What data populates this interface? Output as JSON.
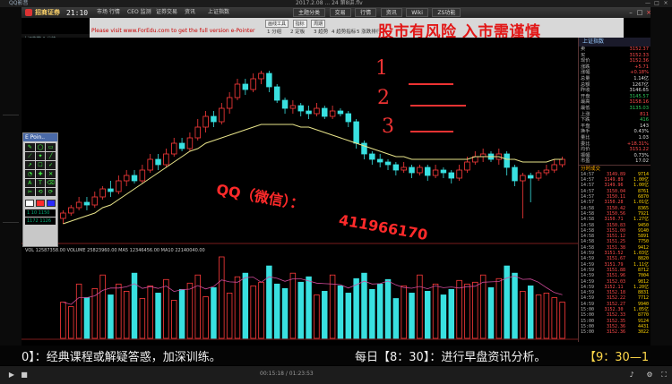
{
  "topbar": {
    "qq_title": "QQ影音",
    "video_info": "2017.2.08 ... 24 第8讲.flv",
    "min": "—",
    "max": "□",
    "close": "×"
  },
  "app": {
    "name": "招商证券",
    "clock": "21:10",
    "menu": [
      "市场 行情",
      "CEO 监测",
      "证券交易",
      "资讯",
      "上证指数"
    ],
    "tabs": [
      "主题分类",
      "交易",
      "行情",
      "资讯",
      "Wiki",
      "ZS功能"
    ],
    "stock_label": "上证指数 1 分钟"
  },
  "banner": {
    "url_text": "Please visit www.ForEdu.com to get the full version e-Pointer",
    "buttons": [
      "1 分组",
      "2 定板",
      "3 趋势",
      "4 趋势指标",
      "5 涨跌排行"
    ],
    "mini_buttons": [
      "画线工具",
      "指标",
      "周期"
    ],
    "warning": "股市有风险 入市需谨慎"
  },
  "point_toolbar": {
    "title": "E Poin..",
    "icons": [
      "✎",
      "◯",
      "▭",
      "⟋",
      "✦",
      "╱",
      "↗",
      "☐",
      "✓",
      "◔",
      "✚",
      "✕",
      "A",
      "T",
      "⌫",
      "✂",
      "⟲",
      "⟳"
    ],
    "colors": [
      "#ffffff",
      "#ff2a2a",
      "#2a2aff"
    ],
    "row1": "1 10 1150",
    "row2": "1172 1126"
  },
  "overlay": {
    "qq_text": "QQ（微信）：",
    "qq_number": "411966170",
    "numbers": [
      "1",
      "2",
      "3"
    ]
  },
  "right_panel": {
    "header": "上证指数",
    "kv": [
      {
        "k": "卖",
        "v": "3152.37",
        "c": "r"
      },
      {
        "k": "买",
        "v": "3152.33",
        "c": "r"
      },
      {
        "k": "现价",
        "v": "3152.36",
        "c": "r"
      },
      {
        "k": "涨跌",
        "v": "+5.71",
        "c": "r"
      },
      {
        "k": "涨幅",
        "v": "+0.18%",
        "c": "r"
      },
      {
        "k": "总量",
        "v": "1.14亿",
        "c": "w"
      },
      {
        "k": "总额",
        "v": "1267亿",
        "c": "w"
      },
      {
        "k": "昨收",
        "v": "3146.65",
        "c": "w"
      },
      {
        "k": "开盘",
        "v": "3145.57",
        "c": "g"
      },
      {
        "k": "最高",
        "v": "3158.16",
        "c": "r"
      },
      {
        "k": "最低",
        "v": "3135.03",
        "c": "g"
      },
      {
        "k": "上涨",
        "v": "811",
        "c": "r"
      },
      {
        "k": "下跌",
        "v": "416",
        "c": "g"
      },
      {
        "k": "平盘",
        "v": "143",
        "c": "w"
      },
      {
        "k": "换手",
        "v": "0.43%",
        "c": "w"
      },
      {
        "k": "量比",
        "v": "1.03",
        "c": "w"
      },
      {
        "k": "委比",
        "v": "+18.31%",
        "c": "r"
      },
      {
        "k": "均价",
        "v": "3151.22",
        "c": "r"
      },
      {
        "k": "振幅",
        "v": "0.73%",
        "c": "w"
      },
      {
        "k": "市盈",
        "v": "17.02",
        "c": "w"
      }
    ],
    "section": "分时成交",
    "trades": [
      {
        "t": "14:57",
        "p": "3149.89",
        "v": "9714"
      },
      {
        "t": "14:57",
        "p": "3149.89",
        "v": "1.00亿"
      },
      {
        "t": "14:57",
        "p": "3149.96",
        "v": "1.00亿"
      },
      {
        "t": "14:57",
        "p": "3150.04",
        "v": "8761"
      },
      {
        "t": "14:57",
        "p": "3150.11",
        "v": "6870"
      },
      {
        "t": "14:57",
        "p": "3150.28",
        "v": "1.01亿"
      },
      {
        "t": "14:58",
        "p": "3150.42",
        "v": "8365"
      },
      {
        "t": "14:58",
        "p": "3150.56",
        "v": "7921"
      },
      {
        "t": "14:58",
        "p": "3150.71",
        "v": "1.27亿"
      },
      {
        "t": "14:58",
        "p": "3150.83",
        "v": "9450"
      },
      {
        "t": "14:58",
        "p": "3151.00",
        "v": "9140"
      },
      {
        "t": "14:58",
        "p": "3151.12",
        "v": "5891"
      },
      {
        "t": "14:58",
        "p": "3151.25",
        "v": "7750"
      },
      {
        "t": "14:58",
        "p": "3151.38",
        "v": "9412"
      },
      {
        "t": "14:59",
        "p": "3151.52",
        "v": "1.03亿"
      },
      {
        "t": "14:59",
        "p": "3151.67",
        "v": "8820"
      },
      {
        "t": "14:59",
        "p": "3151.79",
        "v": "1.11亿"
      },
      {
        "t": "14:59",
        "p": "3151.88",
        "v": "8712"
      },
      {
        "t": "14:59",
        "p": "3151.96",
        "v": "7004"
      },
      {
        "t": "14:59",
        "p": "3152.03",
        "v": "9812"
      },
      {
        "t": "14:59",
        "p": "3152.11",
        "v": "1.20亿"
      },
      {
        "t": "14:59",
        "p": "3152.18",
        "v": "8831"
      },
      {
        "t": "14:59",
        "p": "3152.22",
        "v": "7712"
      },
      {
        "t": "14:59",
        "p": "3152.27",
        "v": "9940"
      },
      {
        "t": "15:00",
        "p": "3152.30",
        "v": "1.05亿"
      },
      {
        "t": "15:00",
        "p": "3152.33",
        "v": "8770"
      },
      {
        "t": "15:00",
        "p": "3152.35",
        "v": "9124"
      },
      {
        "t": "15:00",
        "p": "3152.36",
        "v": "4431"
      },
      {
        "t": "15:00",
        "p": "3152.36",
        "v": "3022"
      }
    ]
  },
  "ticker": {
    "left": "0】：经典课程或解疑答惑，加深训练。",
    "right": "每日【8：30】：进行早盘资讯分析。",
    "right2": "【9：30—1"
  },
  "player": {
    "time": "00:15:18 / 01:23:53"
  },
  "chart_data": {
    "type": "candlestick",
    "title": "",
    "ma_label": "MA",
    "vol_label": "VOL  12587358.00  VOLUME 25823960.00  MA5  12346456.00  MA10  22140040.00",
    "candles": [
      {
        "o": 6,
        "c": 8,
        "h": 9,
        "l": 4
      },
      {
        "o": 8,
        "c": 10,
        "h": 11,
        "l": 7
      },
      {
        "o": 10,
        "c": 12,
        "h": 14,
        "l": 9
      },
      {
        "o": 12,
        "c": 11,
        "h": 14,
        "l": 9
      },
      {
        "o": 11,
        "c": 14,
        "h": 16,
        "l": 10
      },
      {
        "o": 14,
        "c": 17,
        "h": 18,
        "l": 13
      },
      {
        "o": 17,
        "c": 16,
        "h": 20,
        "l": 14
      },
      {
        "o": 16,
        "c": 20,
        "h": 22,
        "l": 15
      },
      {
        "o": 20,
        "c": 22,
        "h": 24,
        "l": 18
      },
      {
        "o": 22,
        "c": 20,
        "h": 24,
        "l": 19
      },
      {
        "o": 20,
        "c": 24,
        "h": 26,
        "l": 19
      },
      {
        "o": 24,
        "c": 28,
        "h": 30,
        "l": 23
      },
      {
        "o": 28,
        "c": 26,
        "h": 30,
        "l": 24
      },
      {
        "o": 26,
        "c": 30,
        "h": 32,
        "l": 25
      },
      {
        "o": 30,
        "c": 34,
        "h": 36,
        "l": 29
      },
      {
        "o": 34,
        "c": 32,
        "h": 36,
        "l": 31
      },
      {
        "o": 32,
        "c": 36,
        "h": 38,
        "l": 31
      },
      {
        "o": 36,
        "c": 40,
        "h": 43,
        "l": 35
      },
      {
        "o": 40,
        "c": 44,
        "h": 46,
        "l": 38
      },
      {
        "o": 44,
        "c": 42,
        "h": 46,
        "l": 40
      },
      {
        "o": 42,
        "c": 47,
        "h": 49,
        "l": 41
      },
      {
        "o": 47,
        "c": 51,
        "h": 53,
        "l": 45
      },
      {
        "o": 51,
        "c": 56,
        "h": 58,
        "l": 50
      },
      {
        "o": 56,
        "c": 54,
        "h": 58,
        "l": 52
      },
      {
        "o": 54,
        "c": 58,
        "h": 60,
        "l": 53
      },
      {
        "o": 58,
        "c": 60,
        "h": 61,
        "l": 56
      },
      {
        "o": 60,
        "c": 55,
        "h": 61,
        "l": 53
      },
      {
        "o": 55,
        "c": 50,
        "h": 56,
        "l": 49
      },
      {
        "o": 50,
        "c": 47,
        "h": 51,
        "l": 45
      },
      {
        "o": 47,
        "c": 48,
        "h": 50,
        "l": 45
      },
      {
        "o": 48,
        "c": 46,
        "h": 49,
        "l": 44
      },
      {
        "o": 46,
        "c": 45,
        "h": 48,
        "l": 43
      },
      {
        "o": 45,
        "c": 47,
        "h": 49,
        "l": 44
      },
      {
        "o": 47,
        "c": 44,
        "h": 48,
        "l": 43
      },
      {
        "o": 44,
        "c": 46,
        "h": 48,
        "l": 43
      },
      {
        "o": 46,
        "c": 45,
        "h": 47,
        "l": 44
      },
      {
        "o": 45,
        "c": 42,
        "h": 46,
        "l": 40
      },
      {
        "o": 42,
        "c": 34,
        "h": 43,
        "l": 32
      },
      {
        "o": 34,
        "c": 30,
        "h": 35,
        "l": 28
      },
      {
        "o": 30,
        "c": 28,
        "h": 31,
        "l": 26
      },
      {
        "o": 28,
        "c": 27,
        "h": 30,
        "l": 25
      },
      {
        "o": 27,
        "c": 26,
        "h": 28,
        "l": 24
      },
      {
        "o": 26,
        "c": 24,
        "h": 27,
        "l": 22
      },
      {
        "o": 24,
        "c": 25,
        "h": 27,
        "l": 23
      },
      {
        "o": 25,
        "c": 23,
        "h": 26,
        "l": 21
      },
      {
        "o": 23,
        "c": 25,
        "h": 26,
        "l": 22
      },
      {
        "o": 25,
        "c": 22,
        "h": 26,
        "l": 20
      },
      {
        "o": 22,
        "c": 24,
        "h": 26,
        "l": 21
      },
      {
        "o": 24,
        "c": 23,
        "h": 25,
        "l": 21
      },
      {
        "o": 23,
        "c": 21,
        "h": 24,
        "l": 19
      },
      {
        "o": 21,
        "c": 24,
        "h": 26,
        "l": 20
      },
      {
        "o": 24,
        "c": 27,
        "h": 29,
        "l": 23
      },
      {
        "o": 27,
        "c": 29,
        "h": 31,
        "l": 26
      },
      {
        "o": 29,
        "c": 30,
        "h": 32,
        "l": 27
      },
      {
        "o": 30,
        "c": 28,
        "h": 31,
        "l": 27
      },
      {
        "o": 28,
        "c": 30,
        "h": 32,
        "l": 26
      },
      {
        "o": 30,
        "c": 25,
        "h": 31,
        "l": 22
      },
      {
        "o": 25,
        "c": 20,
        "h": 26,
        "l": 18
      },
      {
        "o": 20,
        "c": 22,
        "h": 23,
        "l": 6
      },
      {
        "o": 22,
        "c": 21,
        "h": 23,
        "l": 12
      },
      {
        "o": 21,
        "c": 23,
        "h": 24,
        "l": 20
      },
      {
        "o": 23,
        "c": 24,
        "h": 26,
        "l": 22
      },
      {
        "o": 24,
        "c": 26,
        "h": 28,
        "l": 23
      },
      {
        "o": 26,
        "c": 28,
        "h": 29,
        "l": 25
      }
    ],
    "ma": [
      4,
      5,
      6,
      7,
      8,
      10,
      11,
      13,
      15,
      17,
      19,
      21,
      23,
      25,
      27,
      29,
      31,
      32,
      34,
      35,
      36,
      37,
      38,
      39,
      40,
      41,
      41,
      41,
      41,
      41,
      40,
      40,
      39,
      38,
      37,
      36,
      35,
      34,
      33,
      32,
      31,
      30,
      29,
      29,
      28,
      28,
      28,
      28,
      28,
      28,
      28,
      28,
      29,
      29,
      29,
      29,
      28,
      28,
      27,
      27,
      27,
      27,
      28,
      28
    ],
    "volume": [
      40,
      35,
      60,
      45,
      55,
      70,
      48,
      60,
      52,
      72,
      44,
      58,
      50,
      65,
      42,
      54,
      61,
      70,
      46,
      56,
      90,
      50,
      68,
      72,
      58,
      62,
      80,
      60,
      55,
      72,
      62,
      68,
      48,
      52,
      70,
      58,
      50,
      66,
      72,
      54,
      60,
      65,
      44,
      58,
      50,
      70,
      52,
      60,
      48,
      54,
      64,
      60,
      62,
      70,
      56,
      66,
      80,
      72,
      52,
      58,
      48,
      50,
      45,
      40
    ],
    "ylim": [
      0,
      70
    ]
  }
}
